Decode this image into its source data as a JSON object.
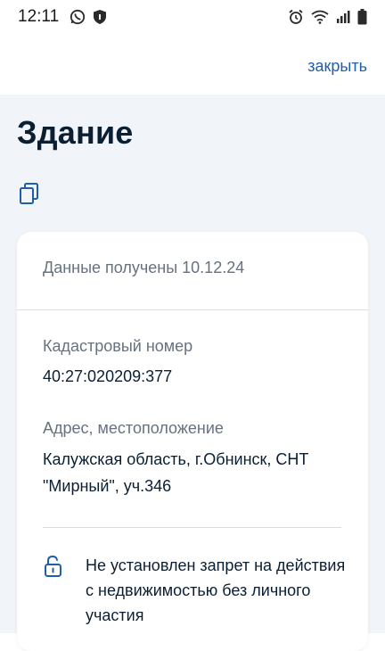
{
  "status_bar": {
    "time": "12:11",
    "left_icons": [
      "whatsapp-icon",
      "shield-icon"
    ],
    "right_icons": [
      "alarm-icon",
      "wifi-icon",
      "signal-icon",
      "battery-icon"
    ]
  },
  "header": {
    "close_label": "закрыть"
  },
  "page": {
    "title": "Здание",
    "copy_icon": "copy-icon"
  },
  "card": {
    "data_received": "Данные получены 10.12.24",
    "cadastral_label": "Кадастровый номер",
    "cadastral_value": "40:27:020209:377",
    "address_label": "Адрес, местоположение",
    "address_value": "Калужская область, г.Обнинск, СНТ \"Мирный\", уч.346",
    "notice_icon": "unlock-icon",
    "notice_text": "Не установлен запрет на действия с недвижимостью без личного участия"
  },
  "colors": {
    "accent": "#1f5ea8",
    "background": "#f1f4f8",
    "text": "#0b1f33",
    "muted": "#66727f"
  }
}
